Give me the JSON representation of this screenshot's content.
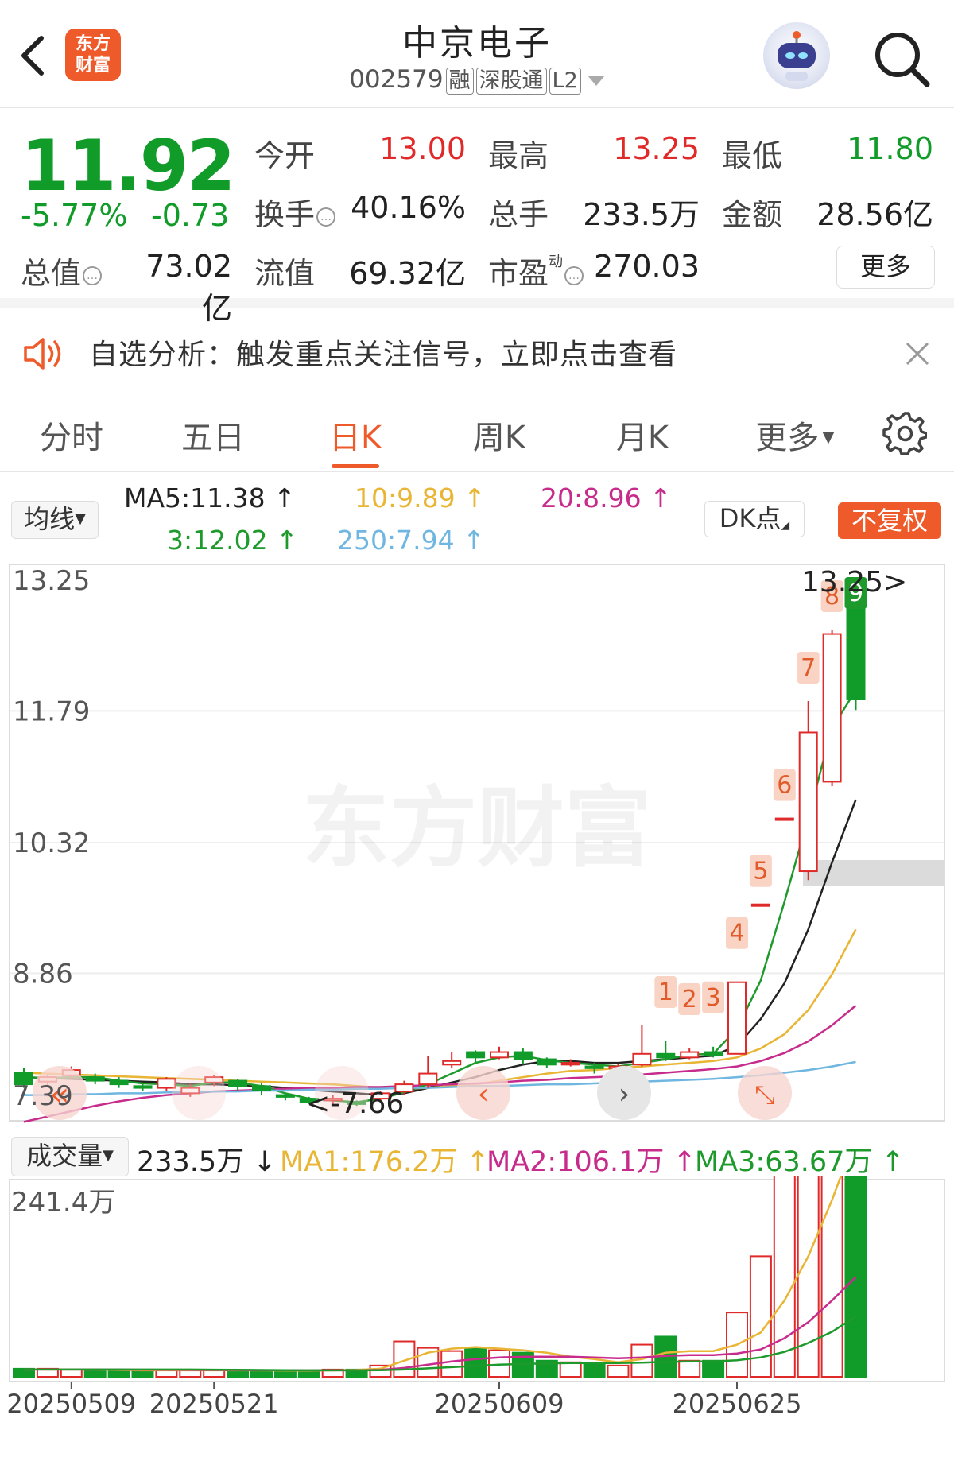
{
  "header": {
    "title": "中京电子",
    "code": "002579",
    "tags": [
      "融",
      "深股通",
      "L2"
    ],
    "logo_text": [
      "东方",
      "财富"
    ],
    "icons": {
      "back": "chevron-left-icon",
      "search": "search-icon",
      "robot": "robot-avatar-icon"
    }
  },
  "quote": {
    "price": "11.92",
    "change_pct": "-5.77%",
    "change": "-0.73",
    "open_label": "今开",
    "open": "13.00",
    "high_label": "最高",
    "high": "13.25",
    "low_label": "最低",
    "low": "11.80",
    "turnover_label": "换手",
    "turnover": "40.16%",
    "volume_label": "总手",
    "volume": "233.5万",
    "amount_label": "金额",
    "amount": "28.56亿",
    "mcap_label": "总值",
    "mcap": "73.02亿",
    "float_label": "流值",
    "float_cap": "69.32亿",
    "pe_label": "市盈",
    "pe_sup": "动",
    "pe": "270.03",
    "more_button": "更多"
  },
  "banner": {
    "text": "自选分析：触发重点关注信号，立即点击查看",
    "icons": {
      "speaker": "speaker-icon",
      "close": "close-icon"
    }
  },
  "tabs": [
    {
      "label": "分时"
    },
    {
      "label": "五日"
    },
    {
      "label": "日K",
      "active": true
    },
    {
      "label": "周K"
    },
    {
      "label": "月K"
    },
    {
      "label": "更多"
    }
  ],
  "ma_bar": {
    "selector": "均线",
    "ma5": "MA5:11.38",
    "ma10": "10:9.89",
    "ma20": "20:8.96",
    "ma3": "3:12.02",
    "ma250": "250:7.94",
    "dk_button": "DK点",
    "adjust_button": "不复权",
    "colors": {
      "ma5": "#222222",
      "ma10": "#e8b535",
      "ma20": "#c72c8c",
      "ma3": "#1e9a2c",
      "ma250": "#6fb6e0"
    }
  },
  "chart_data": {
    "type": "candlestick",
    "y_axis_labels": [
      "13.25",
      "11.79",
      "10.32",
      "8.86",
      "7.39"
    ],
    "ylim": [
      7.39,
      13.25
    ],
    "watermark": "东方财富",
    "max_label": "13.25",
    "min_label": "<-7.66",
    "signals": [
      "1",
      "2",
      "3",
      "4",
      "5",
      "6",
      "7",
      "8",
      "9"
    ],
    "x_labels": [
      "20250509",
      "20250521",
      "20250609",
      "20250625"
    ],
    "candles": [
      {
        "o": 7.75,
        "c": 7.62,
        "h": 7.8,
        "l": 7.58
      },
      {
        "o": 7.65,
        "c": 7.7,
        "h": 7.72,
        "l": 7.6
      },
      {
        "o": 7.72,
        "c": 7.78,
        "h": 7.82,
        "l": 7.68
      },
      {
        "o": 7.7,
        "c": 7.66,
        "h": 7.74,
        "l": 7.62
      },
      {
        "o": 7.66,
        "c": 7.62,
        "h": 7.7,
        "l": 7.58
      },
      {
        "o": 7.6,
        "c": 7.58,
        "h": 7.62,
        "l": 7.55
      },
      {
        "o": 7.58,
        "c": 7.68,
        "h": 7.7,
        "l": 7.55
      },
      {
        "o": 7.52,
        "c": 7.58,
        "h": 7.62,
        "l": 7.48
      },
      {
        "o": 7.64,
        "c": 7.7,
        "h": 7.72,
        "l": 7.6
      },
      {
        "o": 7.66,
        "c": 7.6,
        "h": 7.68,
        "l": 7.55
      },
      {
        "o": 7.6,
        "c": 7.55,
        "h": 7.64,
        "l": 7.5
      },
      {
        "o": 7.5,
        "c": 7.48,
        "h": 7.52,
        "l": 7.44
      },
      {
        "o": 7.46,
        "c": 7.42,
        "h": 7.48,
        "l": 7.4
      },
      {
        "o": 7.44,
        "c": 7.46,
        "h": 7.5,
        "l": 7.4
      },
      {
        "o": 7.42,
        "c": 7.4,
        "h": 7.44,
        "l": 7.38
      },
      {
        "o": 7.46,
        "c": 7.52,
        "h": 7.54,
        "l": 7.42
      },
      {
        "o": 7.54,
        "c": 7.62,
        "h": 7.66,
        "l": 7.5
      },
      {
        "o": 7.62,
        "c": 7.74,
        "h": 7.94,
        "l": 7.58
      },
      {
        "o": 7.84,
        "c": 7.88,
        "h": 7.98,
        "l": 7.8
      },
      {
        "o": 7.98,
        "c": 7.92,
        "h": 8.0,
        "l": 7.86
      },
      {
        "o": 7.92,
        "c": 7.98,
        "h": 8.04,
        "l": 7.9
      },
      {
        "o": 7.98,
        "c": 7.9,
        "h": 8.02,
        "l": 7.84
      },
      {
        "o": 7.9,
        "c": 7.84,
        "h": 7.92,
        "l": 7.8
      },
      {
        "o": 7.84,
        "c": 7.86,
        "h": 7.9,
        "l": 7.82
      },
      {
        "o": 7.82,
        "c": 7.8,
        "h": 7.86,
        "l": 7.74
      },
      {
        "o": 7.8,
        "c": 7.82,
        "h": 7.85,
        "l": 7.76
      },
      {
        "o": 7.84,
        "c": 7.96,
        "h": 8.28,
        "l": 7.82
      },
      {
        "o": 7.96,
        "c": 7.92,
        "h": 8.1,
        "l": 7.88
      },
      {
        "o": 7.92,
        "c": 7.98,
        "h": 8.02,
        "l": 7.9
      },
      {
        "o": 7.98,
        "c": 7.94,
        "h": 8.04,
        "l": 7.92
      },
      {
        "o": 7.96,
        "c": 8.76,
        "h": 8.76,
        "l": 7.96
      },
      {
        "o": 9.63,
        "c": 9.63,
        "h": 9.63,
        "l": 9.63
      },
      {
        "o": 10.59,
        "c": 10.59,
        "h": 10.59,
        "l": 10.59
      },
      {
        "o": 10.0,
        "c": 11.55,
        "h": 11.9,
        "l": 9.9
      },
      {
        "o": 11.0,
        "c": 12.65,
        "h": 12.7,
        "l": 10.95
      },
      {
        "o": 13.0,
        "c": 11.92,
        "h": 13.25,
        "l": 11.8
      }
    ],
    "ma_lines": {
      "ma5": [
        7.7,
        7.69,
        7.68,
        7.67,
        7.66,
        7.65,
        7.64,
        7.62,
        7.62,
        7.61,
        7.6,
        7.58,
        7.56,
        7.54,
        7.52,
        7.5,
        7.52,
        7.58,
        7.64,
        7.7,
        7.78,
        7.84,
        7.88,
        7.88,
        7.86,
        7.86,
        7.88,
        7.9,
        7.92,
        7.94,
        8.05,
        8.35,
        8.75,
        9.35,
        10.1,
        10.8
      ],
      "ma10": [
        7.75,
        7.74,
        7.73,
        7.72,
        7.71,
        7.7,
        7.69,
        7.68,
        7.67,
        7.66,
        7.65,
        7.64,
        7.63,
        7.62,
        7.6,
        7.58,
        7.57,
        7.58,
        7.6,
        7.62,
        7.66,
        7.7,
        7.74,
        7.77,
        7.78,
        7.8,
        7.82,
        7.84,
        7.86,
        7.88,
        7.92,
        8.02,
        8.18,
        8.45,
        8.85,
        9.35
      ],
      "ma20": [
        7.2,
        7.26,
        7.32,
        7.38,
        7.43,
        7.47,
        7.5,
        7.52,
        7.54,
        7.55,
        7.56,
        7.57,
        7.58,
        7.58,
        7.59,
        7.59,
        7.6,
        7.61,
        7.62,
        7.63,
        7.64,
        7.66,
        7.67,
        7.69,
        7.7,
        7.71,
        7.73,
        7.75,
        7.77,
        7.79,
        7.82,
        7.88,
        7.97,
        8.1,
        8.28,
        8.5
      ],
      "ma3": [
        7.7,
        7.69,
        7.7,
        7.7,
        7.66,
        7.63,
        7.62,
        7.6,
        7.64,
        7.64,
        7.6,
        7.52,
        7.46,
        7.44,
        7.42,
        7.46,
        7.53,
        7.62,
        7.74,
        7.86,
        7.92,
        7.94,
        7.89,
        7.86,
        7.84,
        7.82,
        7.86,
        7.9,
        7.95,
        7.96,
        8.24,
        8.78,
        9.66,
        10.6,
        11.6,
        12.02
      ],
      "ma250": [
        7.5,
        7.5,
        7.51,
        7.51,
        7.52,
        7.52,
        7.53,
        7.53,
        7.54,
        7.54,
        7.55,
        7.55,
        7.56,
        7.56,
        7.57,
        7.57,
        7.58,
        7.58,
        7.59,
        7.6,
        7.6,
        7.61,
        7.62,
        7.62,
        7.63,
        7.64,
        7.65,
        7.66,
        7.67,
        7.68,
        7.7,
        7.72,
        7.75,
        7.78,
        7.82,
        7.87
      ]
    }
  },
  "volume_bar": {
    "selector": "成交量",
    "value": "233.5万",
    "ma1": "MA1:176.2万",
    "ma2": "MA2:106.1万",
    "ma3": "MA3:63.67万",
    "y_label": "241.4万",
    "volumes": [
      10,
      10,
      9,
      9,
      8,
      8,
      8,
      8,
      8,
      8,
      8,
      7,
      7,
      9,
      9,
      14,
      44,
      36,
      32,
      36,
      33,
      30,
      20,
      18,
      16,
      14,
      40,
      50,
      20,
      20,
      80,
      150,
      300,
      380,
      420,
      390
    ],
    "ma1_line": [
      9,
      9,
      9,
      9,
      8.5,
      8,
      8,
      8,
      8,
      8,
      8,
      7.8,
      7.5,
      8,
      8.5,
      10,
      20,
      30,
      35,
      37,
      35,
      33,
      30,
      25,
      22,
      18,
      22,
      30,
      32,
      32,
      40,
      55,
      95,
      150,
      220,
      300
    ],
    "ma2_line": [
      9,
      9,
      9,
      9,
      9,
      8.8,
      8.6,
      8.5,
      8.4,
      8.3,
      8.2,
      8.1,
      8,
      8,
      8,
      8.5,
      11,
      15,
      19,
      22,
      24,
      25,
      25,
      25,
      24,
      23,
      24,
      26,
      27,
      27,
      29,
      34,
      48,
      68,
      95,
      124
    ],
    "ma3_line": [
      9,
      9,
      9,
      9,
      9,
      9,
      9,
      9,
      8.8,
      8.6,
      8.4,
      8.2,
      8,
      8,
      8,
      8.2,
      9,
      10.5,
      12,
      13.5,
      15,
      16,
      16.5,
      17,
      17,
      17,
      17.5,
      18.5,
      19,
      19,
      20.5,
      24,
      31,
      42,
      56,
      75
    ]
  }
}
